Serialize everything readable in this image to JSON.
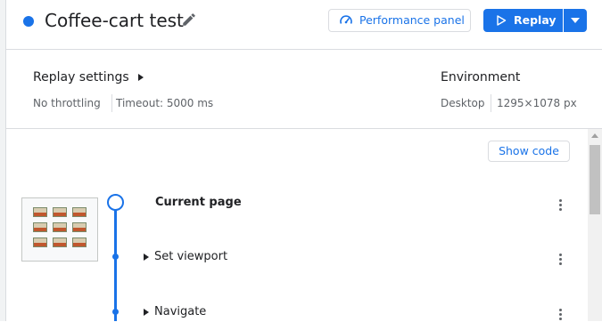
{
  "header": {
    "title": "Coffee-cart test",
    "status_color": "#1a73e8",
    "edit_icon": "pencil-icon",
    "performance_button": {
      "label": "Performance panel",
      "icon": "gauge-icon"
    },
    "replay_button": {
      "label": "Replay",
      "icon": "play-icon"
    },
    "replay_menu_icon": "triangle-down-icon"
  },
  "settings": {
    "title": "Replay settings",
    "throttling": "No throttling",
    "timeout": "Timeout: 5000 ms",
    "environment_title": "Environment",
    "device": "Desktop",
    "viewport": "1295×1078 px"
  },
  "content": {
    "show_code_label": "Show code",
    "steps": [
      {
        "label": "Current page",
        "expandable": false
      },
      {
        "label": "Set viewport",
        "expandable": true
      },
      {
        "label": "Navigate",
        "expandable": true
      }
    ]
  },
  "colors": {
    "accent": "#1a73e8",
    "border": "#dadce0",
    "muted_text": "#5f6368"
  }
}
